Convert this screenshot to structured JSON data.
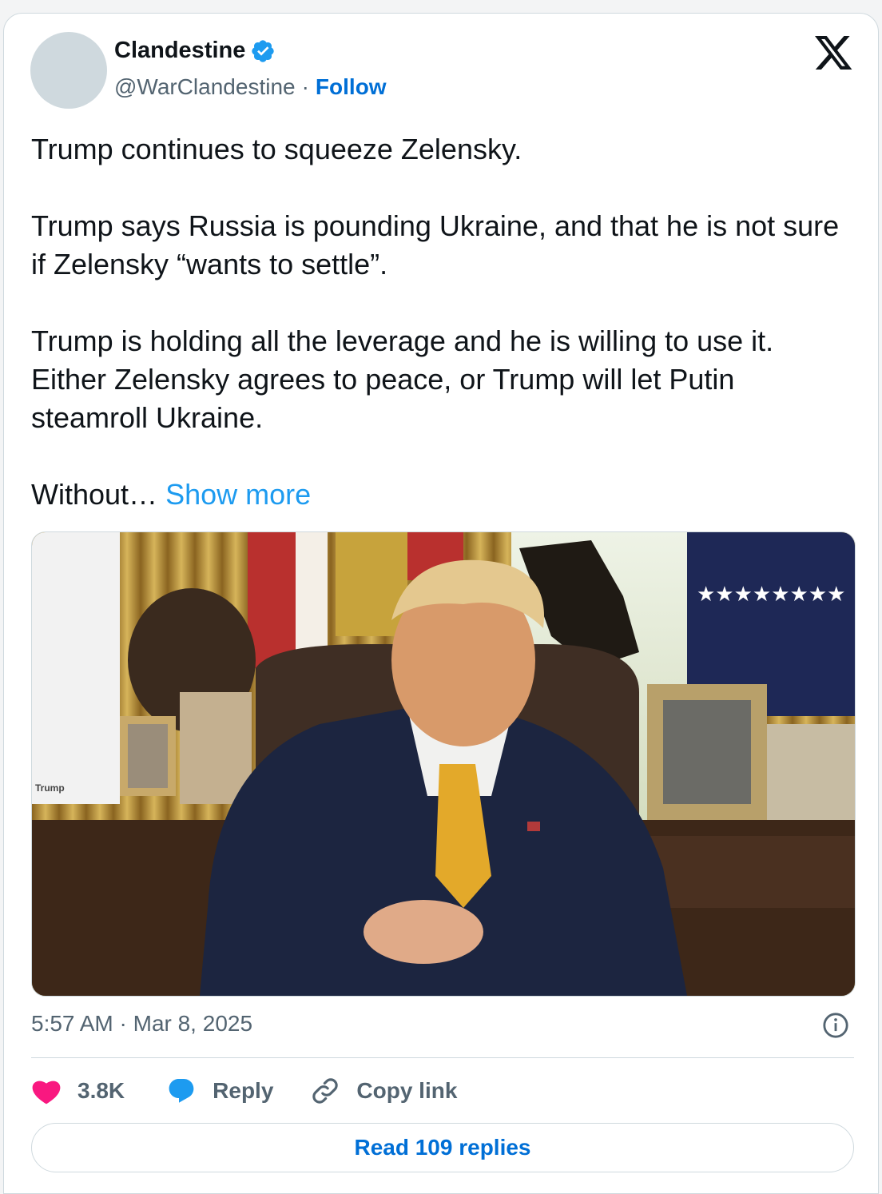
{
  "author": {
    "name": "Clandestine",
    "handle": "@WarClandestine",
    "separator": "·",
    "follow_label": "Follow"
  },
  "tweet": {
    "paragraphs": [
      "Trump continues to squeeze Zelensky.",
      "Trump says Russia is pounding Ukraine, and that he is not sure if Zelensky “wants to settle”.",
      "Trump is holding all the leverage and he is willing to use it. Either Zelensky agrees to peace, or Trump will let Putin steamroll Ukraine."
    ],
    "truncated_text": "Without…",
    "show_more_label": "Show more"
  },
  "media": {
    "placard_text": "Trump"
  },
  "timestamp": "5:57 AM · Mar 8, 2025",
  "actions": {
    "like_count": "3.8K",
    "reply_label": "Reply",
    "copy_link_label": "Copy link"
  },
  "read_replies_label": "Read 109 replies",
  "colors": {
    "link": "#1d9bf0",
    "follow": "#006fd6",
    "heart": "#f91880",
    "reply_bubble": "#1d9bf0",
    "verified": "#1d9bf0",
    "muted": "#536471"
  },
  "icons": [
    "verified-badge-icon",
    "x-logo-icon",
    "info-icon",
    "heart-icon",
    "reply-bubble-icon",
    "link-icon"
  ]
}
